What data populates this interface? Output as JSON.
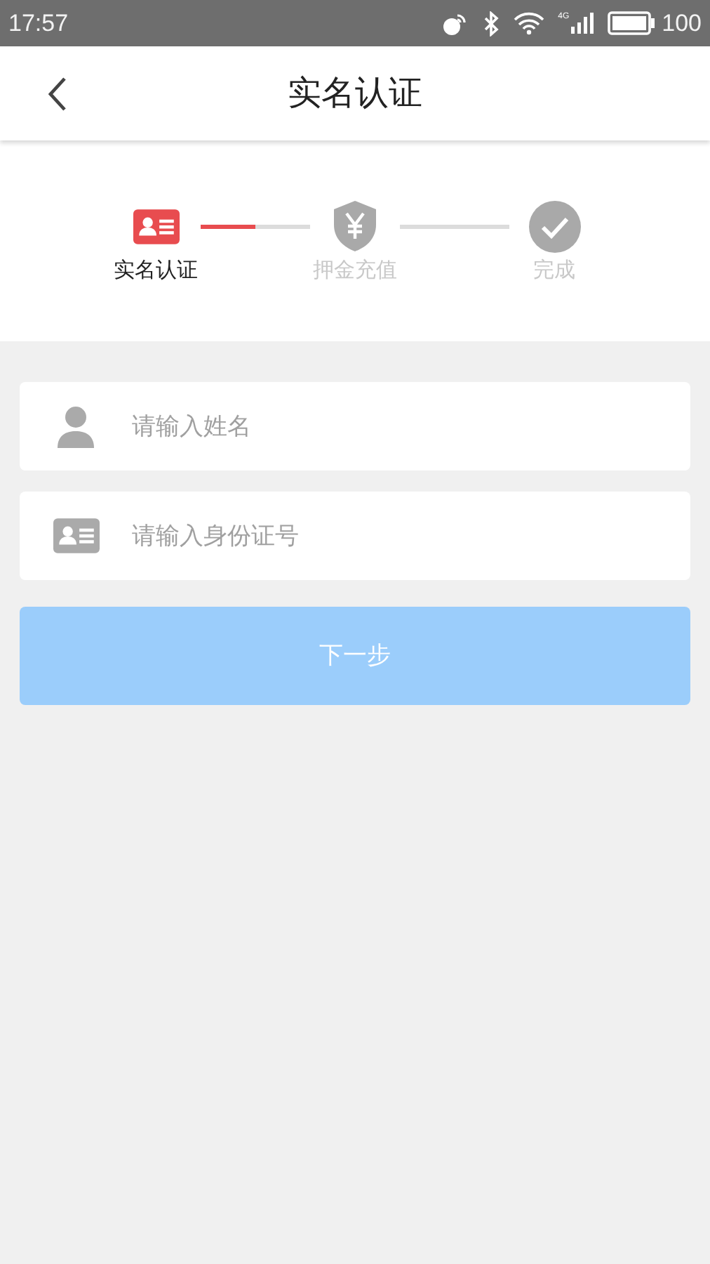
{
  "status_bar": {
    "time": "17:57",
    "network": "4G",
    "battery": "100"
  },
  "header": {
    "title": "实名认证"
  },
  "steps": [
    {
      "kind": "idcard",
      "label": "实名认证",
      "selected": true,
      "level": 0.5
    },
    {
      "kind": "shield",
      "label": "押金充值",
      "selected": false
    },
    {
      "kind": "check",
      "label": "完成",
      "selected": false
    }
  ],
  "fields": [
    {
      "kind": "person",
      "placeholder": "请输入姓名"
    },
    {
      "kind": "idcard",
      "placeholder": "请输入身份证号"
    }
  ],
  "next_button": {
    "label": "下一步",
    "disabled": true
  }
}
